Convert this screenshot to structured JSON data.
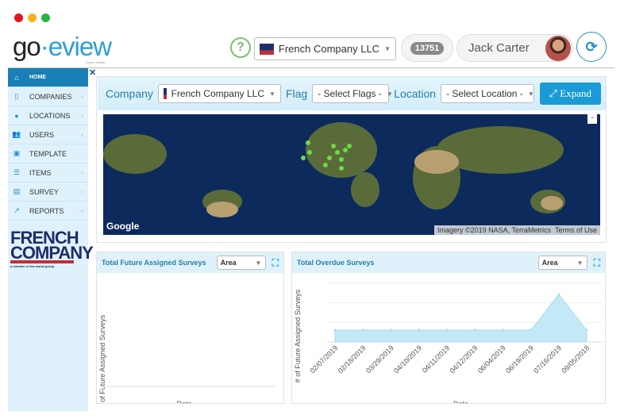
{
  "window": {
    "dots": [
      "#e0161c",
      "#f3b51b",
      "#26b53e"
    ]
  },
  "header": {
    "logo": "go·eview",
    "tagline": "Onsite Insight",
    "company_select": "French Company LLC",
    "count": "13751",
    "user": "Jack Carter",
    "help_icon": "question-circle-icon",
    "refresh_icon": "refresh-icon"
  },
  "sidebar": {
    "items": [
      {
        "label": "HOME",
        "icon": "home-icon"
      },
      {
        "label": "COMPANIES",
        "icon": "building-icon"
      },
      {
        "label": "LOCATIONS",
        "icon": "map-marker-icon"
      },
      {
        "label": "USERS",
        "icon": "users-icon"
      },
      {
        "label": "TEMPLATE",
        "icon": "template-icon"
      },
      {
        "label": "ITEMS",
        "icon": "list-icon"
      },
      {
        "label": "SURVEY",
        "icon": "survey-icon"
      },
      {
        "label": "REPORTS",
        "icon": "line-chart-icon"
      }
    ],
    "brand": {
      "line1": "FRENCH",
      "line2": "COMPANY",
      "sub": "a member of the wanzl group"
    }
  },
  "filters": {
    "company_label": "Company",
    "company_value": "French Company LLC",
    "flag_label": "Flag",
    "flag_value": "- Select Flags -",
    "location_label": "Location",
    "location_value": "- Select Location -",
    "expand_label": "Expand"
  },
  "map": {
    "attribution": "Imagery ©2019 NASA, TerraMetrics",
    "terms": "Terms of Use",
    "google": "Google",
    "zoom_out": "-"
  },
  "charts": {
    "left": {
      "title": "Total Future Assigned Surveys",
      "type_select": "Area"
    },
    "right": {
      "title": "Total Overdue Surveys",
      "type_select": "Area"
    }
  },
  "chart_data": [
    {
      "type": "area",
      "title": "Total Future Assigned Surveys",
      "xlabel": "Date",
      "ylabel": "# of Future Assigned Surveys",
      "categories": [],
      "values": []
    },
    {
      "type": "area",
      "title": "Total Overdue Surveys",
      "xlabel": "Date",
      "ylabel": "# of Future Assigned Surveys",
      "categories": [
        "02/07/2019",
        "02/18/2019",
        "03/29/2019",
        "04/10/2019",
        "04/11/2019",
        "04/12/2019",
        "06/04/2019",
        "06/19/2019",
        "07/16/2019",
        "09/05/2018"
      ],
      "values": [
        1,
        1,
        1,
        1,
        1,
        1,
        1,
        1,
        4,
        1
      ],
      "ylim": [
        0,
        5
      ],
      "grid": true,
      "color": "#c3e9f7"
    }
  ]
}
